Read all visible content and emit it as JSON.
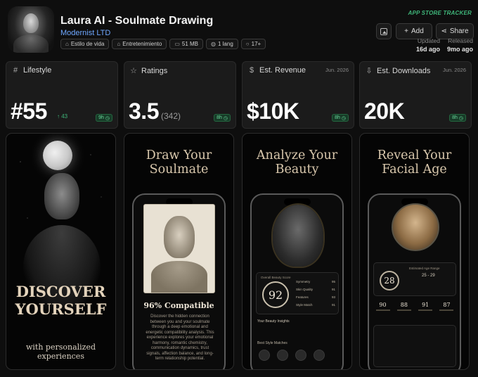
{
  "app": {
    "title": "Laura AI - Soulmate Drawing",
    "developer": "Modernist LTD",
    "tags": [
      {
        "icon": "tag-icon",
        "glyph": "⌂",
        "label": "Estilo de vida"
      },
      {
        "icon": "tag-icon",
        "glyph": "⌂",
        "label": "Entretenimiento"
      },
      {
        "icon": "storage-icon",
        "glyph": "▭",
        "label": "51 MB"
      },
      {
        "icon": "globe-icon",
        "glyph": "◍",
        "label": "1 lang"
      },
      {
        "icon": "age-rating-icon",
        "glyph": "○",
        "label": "17+"
      }
    ]
  },
  "header": {
    "tracker_label": "APP STORE TRACKER",
    "add_label": "Add",
    "share_label": "Share",
    "updated_key": "Updated",
    "updated_value": "16d ago",
    "released_key": "Released",
    "released_value": "9mo ago"
  },
  "stats": [
    {
      "label": "Lifestyle",
      "icon": "hash-icon",
      "glyph": "#",
      "date": "",
      "value": "#55",
      "sub": "",
      "delta": "↑ 43",
      "badge": "9h"
    },
    {
      "label": "Ratings",
      "icon": "star-icon",
      "glyph": "☆",
      "date": "",
      "value": "3.5",
      "sub": "(342)",
      "delta": "",
      "badge": "8h"
    },
    {
      "label": "Est. Revenue",
      "icon": "dollar-icon",
      "glyph": "$",
      "date": "Jun. 2026",
      "value": "$10K",
      "sub": "",
      "delta": "",
      "badge": "8h"
    },
    {
      "label": "Est. Downloads",
      "icon": "download-icon",
      "glyph": "⇩",
      "date": "Jun. 2026",
      "value": "20K",
      "sub": "",
      "delta": "",
      "badge": "8h"
    }
  ],
  "screenshots": [
    {
      "title": "",
      "headline": "DISCOVER YOURSELF",
      "sub": "with personalized experiences"
    },
    {
      "title": "Draw Your Soulmate",
      "compat": "96% Compatible",
      "desc": "Discover the hidden connection between you and your soulmate through a deep emotional and energetic compatibility analysis. This experience explores your emotional harmony, romantic chemistry, communication dynamics, trust signals, affection balance, and long-term relationship potential."
    },
    {
      "title": "Analyze Your Beauty",
      "score": "92",
      "score_label": "Overall Beauty Score",
      "rows": [
        [
          "Symmetry",
          "95"
        ],
        [
          "Skin Quality",
          "91"
        ],
        [
          "Features",
          "93"
        ],
        [
          "Style Match",
          "91"
        ]
      ],
      "insights": "Your Beauty Insights",
      "matches": "Best Style Matches"
    },
    {
      "title": "Reveal Your Facial Age",
      "age": "28",
      "age_label": "Estimated Age Range",
      "age_range": "25 - 29",
      "metrics": [
        "90",
        "88",
        "91",
        "87"
      ]
    }
  ]
}
